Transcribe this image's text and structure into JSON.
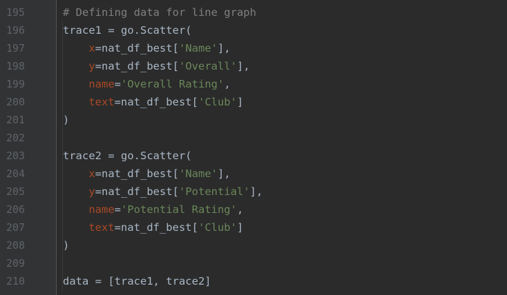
{
  "editor": {
    "colors": {
      "background": "#2b2b2b",
      "gutter": "#313335",
      "line_number": "#606366",
      "plain": "#a9b7c6",
      "comment": "#808080",
      "param": "#aa4926",
      "string": "#6a8759"
    },
    "lines": [
      {
        "number": "195",
        "tokens": [
          {
            "t": "comment",
            "v": "# Defining data for line graph"
          }
        ]
      },
      {
        "number": "196",
        "tokens": [
          {
            "t": "plain",
            "v": "trace1 = go.Scatter("
          }
        ]
      },
      {
        "number": "197",
        "tokens": [
          {
            "t": "plain",
            "v": "    "
          },
          {
            "t": "param",
            "v": "x"
          },
          {
            "t": "plain",
            "v": "=nat_df_best["
          },
          {
            "t": "string",
            "v": "'Name'"
          },
          {
            "t": "plain",
            "v": "],"
          }
        ]
      },
      {
        "number": "198",
        "tokens": [
          {
            "t": "plain",
            "v": "    "
          },
          {
            "t": "param",
            "v": "y"
          },
          {
            "t": "plain",
            "v": "=nat_df_best["
          },
          {
            "t": "string",
            "v": "'Overall'"
          },
          {
            "t": "plain",
            "v": "],"
          }
        ]
      },
      {
        "number": "199",
        "tokens": [
          {
            "t": "plain",
            "v": "    "
          },
          {
            "t": "param",
            "v": "name"
          },
          {
            "t": "plain",
            "v": "="
          },
          {
            "t": "string",
            "v": "'Overall Rating'"
          },
          {
            "t": "plain",
            "v": ","
          }
        ]
      },
      {
        "number": "200",
        "tokens": [
          {
            "t": "plain",
            "v": "    "
          },
          {
            "t": "param",
            "v": "text"
          },
          {
            "t": "plain",
            "v": "=nat_df_best["
          },
          {
            "t": "string",
            "v": "'Club'"
          },
          {
            "t": "plain",
            "v": "]"
          }
        ]
      },
      {
        "number": "201",
        "tokens": [
          {
            "t": "plain",
            "v": ")"
          }
        ]
      },
      {
        "number": "202",
        "tokens": []
      },
      {
        "number": "203",
        "tokens": [
          {
            "t": "plain",
            "v": "trace2 = go.Scatter("
          }
        ]
      },
      {
        "number": "204",
        "tokens": [
          {
            "t": "plain",
            "v": "    "
          },
          {
            "t": "param",
            "v": "x"
          },
          {
            "t": "plain",
            "v": "=nat_df_best["
          },
          {
            "t": "string",
            "v": "'Name'"
          },
          {
            "t": "plain",
            "v": "],"
          }
        ]
      },
      {
        "number": "205",
        "tokens": [
          {
            "t": "plain",
            "v": "    "
          },
          {
            "t": "param",
            "v": "y"
          },
          {
            "t": "plain",
            "v": "=nat_df_best["
          },
          {
            "t": "string",
            "v": "'Potential'"
          },
          {
            "t": "plain",
            "v": "],"
          }
        ]
      },
      {
        "number": "206",
        "tokens": [
          {
            "t": "plain",
            "v": "    "
          },
          {
            "t": "param",
            "v": "name"
          },
          {
            "t": "plain",
            "v": "="
          },
          {
            "t": "string",
            "v": "'Potential Rating'"
          },
          {
            "t": "plain",
            "v": ","
          }
        ]
      },
      {
        "number": "207",
        "tokens": [
          {
            "t": "plain",
            "v": "    "
          },
          {
            "t": "param",
            "v": "text"
          },
          {
            "t": "plain",
            "v": "=nat_df_best["
          },
          {
            "t": "string",
            "v": "'Club'"
          },
          {
            "t": "plain",
            "v": "]"
          }
        ]
      },
      {
        "number": "208",
        "tokens": [
          {
            "t": "plain",
            "v": ")"
          }
        ]
      },
      {
        "number": "209",
        "tokens": []
      },
      {
        "number": "210",
        "tokens": [
          {
            "t": "plain",
            "v": "data = [trace1, trace2]"
          }
        ]
      }
    ]
  }
}
